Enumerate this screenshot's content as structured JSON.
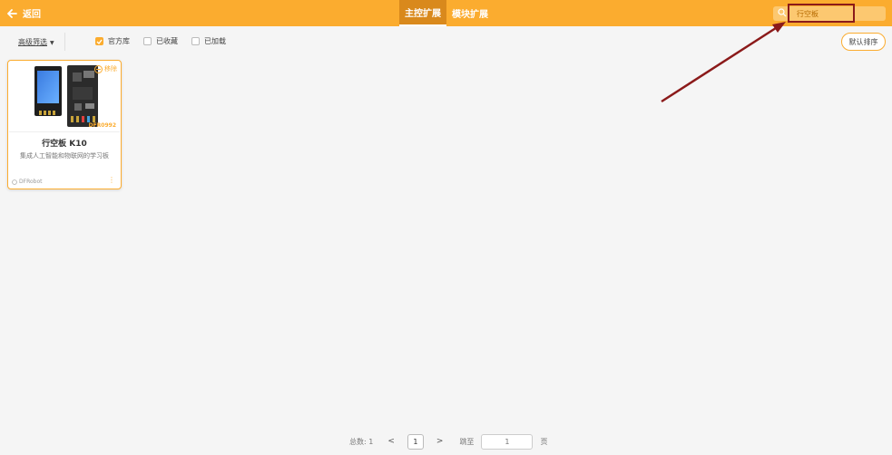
{
  "header": {
    "back_label": "返回",
    "tabs": [
      {
        "label": "主控扩展",
        "active": true
      },
      {
        "label": "模块扩展",
        "active": false
      }
    ],
    "search": {
      "value": "行空板",
      "icon": "search-icon"
    }
  },
  "filters": {
    "advanced_label": "高级筛选",
    "checkboxes": [
      {
        "label": "官方库",
        "checked": true
      },
      {
        "label": "已收藏",
        "checked": false
      },
      {
        "label": "已加载",
        "checked": false
      }
    ],
    "sort_label": "默认排序"
  },
  "cards": [
    {
      "title": "行空板 K10",
      "description": "集成人工智能和物联网的学习板",
      "sku": "DFR0992",
      "remove_label": "移除",
      "author": "DFRobot"
    }
  ],
  "pagination": {
    "total_label": "总数:",
    "total": "1",
    "prev": "<",
    "current_page": "1",
    "next": ">",
    "jump_label": "跳至",
    "jump_value": "1",
    "page_unit": "页"
  },
  "colors": {
    "accent": "#fbac2f",
    "annotation": "#8b1a1a"
  }
}
